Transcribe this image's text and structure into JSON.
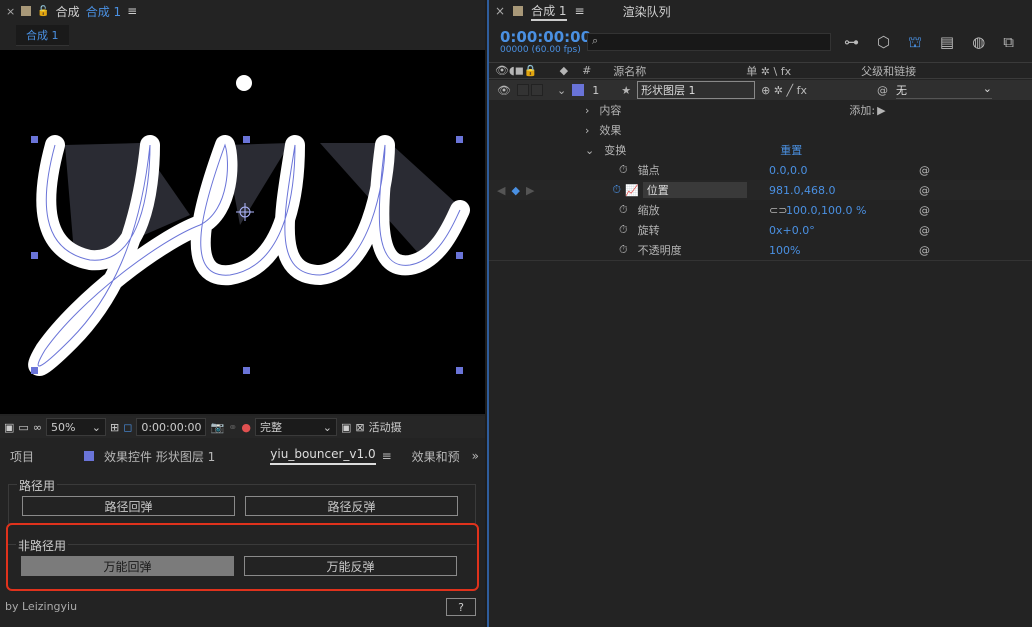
{
  "comp_panel": {
    "title_prefix": "合成",
    "comp_name": "合成 1",
    "tab_label": "合成 1"
  },
  "viewer_toolbar": {
    "zoom": "50%",
    "timecode": "0:00:00:00",
    "quality": "完整",
    "active_camera": "活动摄"
  },
  "bottom_tabs": {
    "project": "项目",
    "effects_controls": "效果控件 形状图层 1",
    "script": "yiu_bouncer_v1.0",
    "presets": "效果和预"
  },
  "script_panel": {
    "group1_label": "路径用",
    "btn_path_bounce": "路径回弹",
    "btn_path_reverse": "路径反弹",
    "group2_label": "非路径用",
    "btn_all_bounce": "万能回弹",
    "btn_all_reverse": "万能反弹",
    "author": "by Leizingyiu",
    "help": "?"
  },
  "timeline": {
    "tab_comp": "合成 1",
    "tab_render": "渲染队列",
    "timecode": "0:00:00:00",
    "frames": "00000 (60.00 fps)",
    "col_num": "#",
    "col_source": "源名称",
    "col_switches": "单 ✲ \\ fx",
    "col_parent": "父级和链接",
    "layer": {
      "num": "1",
      "name": "形状图层 1",
      "parent": "无"
    },
    "content_label": "内容",
    "add_label": "添加:",
    "effects_label": "效果",
    "transform_label": "变换",
    "reset_label": "重置",
    "properties": [
      {
        "name": "锚点",
        "value": "0.0,0.0"
      },
      {
        "name": "位置",
        "value": "981.0,468.0"
      },
      {
        "name": "缩放",
        "value": "100.0,100.0 %"
      },
      {
        "name": "旋转",
        "value": "0x+0.0°"
      },
      {
        "name": "不透明度",
        "value": "100%"
      }
    ]
  },
  "colors": {
    "accent_blue": "#4a90e2",
    "label_purple": "#6a74d8",
    "highlight_red": "#e0321c"
  }
}
